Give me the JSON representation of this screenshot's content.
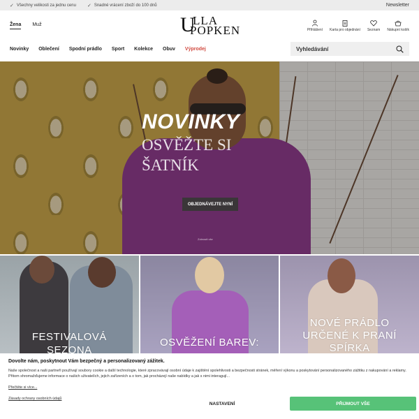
{
  "topbar": {
    "usp": [
      "Všechny velikosti za jednu cenu",
      "Snadné vrácení zboží do 100 dnů"
    ],
    "newsletter": "Newsletter"
  },
  "header": {
    "gender_tabs": [
      "Žena",
      "Muž"
    ],
    "logo_line1": "LLA",
    "logo_line2": "POPKEN",
    "logo_u": "U",
    "actions": [
      {
        "icon": "user-icon",
        "label": "Přihlášení"
      },
      {
        "icon": "clipboard-icon",
        "label": "Karta pro objednání"
      },
      {
        "icon": "heart-icon",
        "label": "Seznam"
      },
      {
        "icon": "basket-icon",
        "label": "Nákupní košík"
      }
    ]
  },
  "nav": {
    "items": [
      "Novinky",
      "Oblečení",
      "Spodní prádlo",
      "Sport",
      "Kolekce",
      "Obuv",
      "Výprodej"
    ],
    "search_placeholder": "Vyhledávání"
  },
  "hero": {
    "title": "NOVINKY",
    "subtitle_line1": "OSVĚŽTE SI",
    "subtitle_line2": "ŠATNÍK",
    "cta": "OBJEDNÁVEJTE NYNÍ",
    "note": "Zobrazit vše"
  },
  "cards": [
    {
      "line1": "FESTIVALOVÁ",
      "line2": "SEZONA"
    },
    {
      "line1": "OSVĚŽENÍ BAREV:",
      "line2": ""
    },
    {
      "line1": "NOVÉ PRÁDLO",
      "line2": "URČENÉ K PRANÍ",
      "line3": "SPÍRKA"
    }
  ],
  "cookie": {
    "title": "Dovolte nám, poskytnout Vám bezpečný a personalizovaný zážitek.",
    "text": "Naše společnost a naši partneři používají soubory cookie a další technologie, které zpracovávají osobní údaje k zajištění spolehlivosti a bezpečnosti stránek, měření výkonu a poskytování personalizovaného zážitku z nakupování a reklamy. Přitom shromažďujeme informace o našich uživatelích, jejich zařízeních a o tom, jak procházejí naše nabídky a jak s nimi interagují...",
    "more": "Přečtěte si více...",
    "policy": "Zásady ochrany osobních údajů",
    "settings": "NASTAVENÍ",
    "accept": "PŘIJMOUT VŠE"
  },
  "colors": {
    "accent_green": "#57c278",
    "sale_red": "#d0493f",
    "cta_dark": "#3a3638"
  }
}
